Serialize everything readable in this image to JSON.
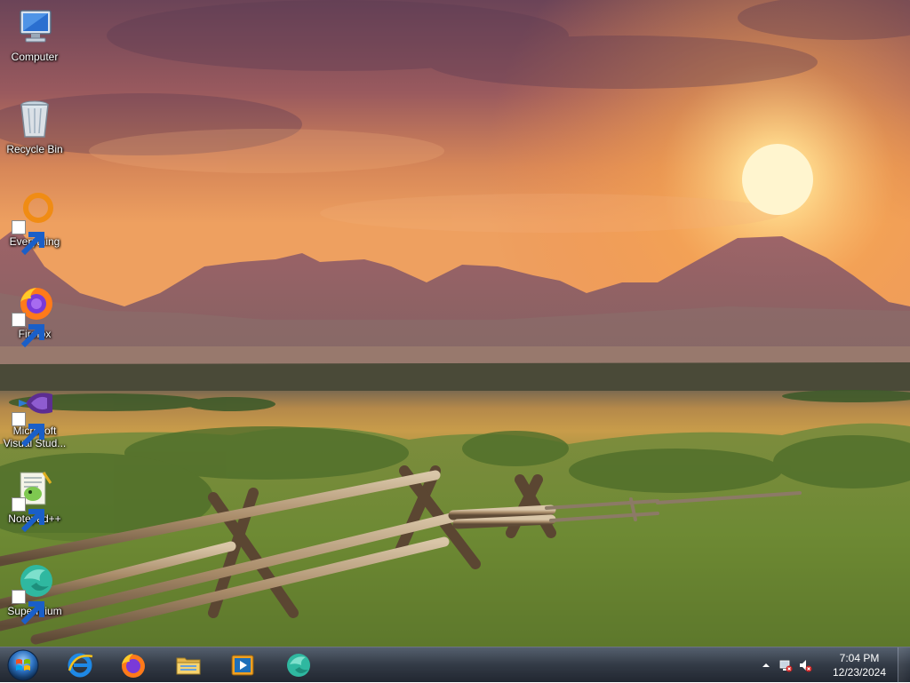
{
  "desktop": {
    "icons": [
      {
        "label": "Computer",
        "icon": "computer-icon",
        "shortcut": false
      },
      {
        "label": "Recycle Bin",
        "icon": "recycle-bin-icon",
        "shortcut": false
      },
      {
        "label": "Everything",
        "icon": "everything-icon",
        "shortcut": true
      },
      {
        "label": "Firefox",
        "icon": "firefox-icon",
        "shortcut": true
      },
      {
        "label": "Microsoft Visual Stud...",
        "icon": "visual-studio-icon",
        "shortcut": true
      },
      {
        "label": "Notepad++",
        "icon": "notepadpp-icon",
        "shortcut": true
      },
      {
        "label": "Supermium",
        "icon": "supermium-icon",
        "shortcut": true
      }
    ]
  },
  "taskbar": {
    "start_icon": "windows-start-orb-icon",
    "pinned": [
      {
        "name": "internet-explorer",
        "icon": "internet-explorer-icon"
      },
      {
        "name": "firefox",
        "icon": "firefox-icon"
      },
      {
        "name": "file-explorer",
        "icon": "file-explorer-icon"
      },
      {
        "name": "media-player",
        "icon": "media-player-icon"
      },
      {
        "name": "supermium",
        "icon": "supermium-icon"
      }
    ],
    "tray": {
      "overflow_icon": "chevron-up-icon",
      "network_icon": "network-icon",
      "volume_icon": "volume-muted-icon",
      "time": "7:04 PM",
      "date": "12/23/2024"
    }
  },
  "colors": {
    "sky_top": "#7a4a5c",
    "sky_glow": "#f5a35a",
    "sun": "#fff2c0",
    "mountains": "#8a5a66",
    "field": "#c99a45",
    "grass": "#6f8a3a"
  }
}
